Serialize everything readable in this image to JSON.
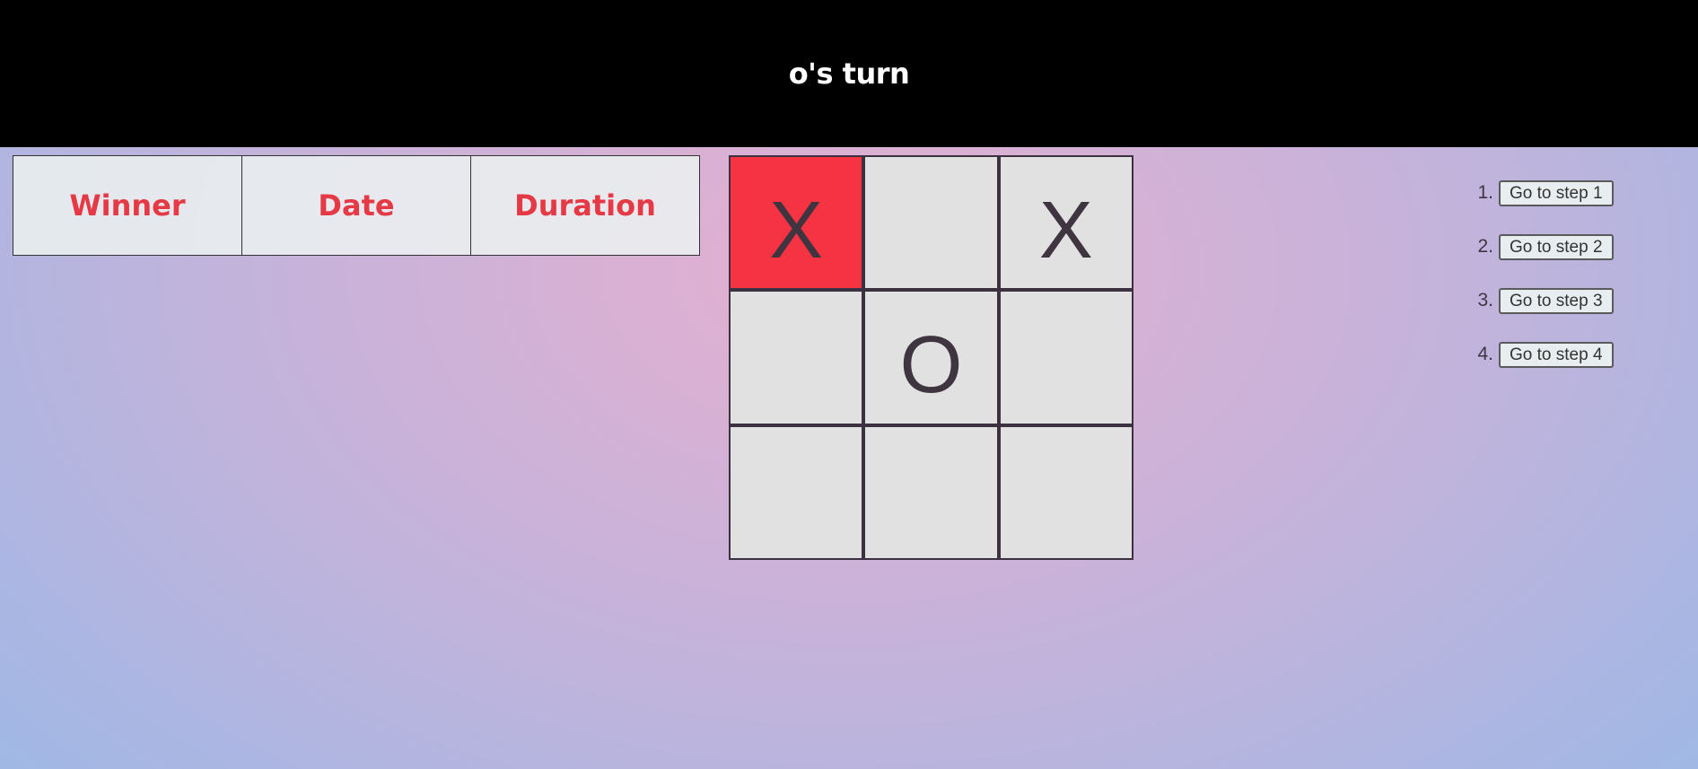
{
  "status": "o's turn",
  "history_table": {
    "headers": [
      "Winner",
      "Date",
      "Duration"
    ]
  },
  "board": {
    "squares": [
      "X",
      "",
      "X",
      "",
      "O",
      "",
      "",
      "",
      ""
    ],
    "highlighted_index": 0,
    "highlight_color": "#f53342"
  },
  "moves": [
    {
      "number": "1.",
      "label": "Go to step 1"
    },
    {
      "number": "2.",
      "label": "Go to step 2"
    },
    {
      "number": "3.",
      "label": "Go to step 3"
    },
    {
      "number": "4.",
      "label": "Go to step 4"
    }
  ],
  "colors": {
    "header_bg": "#000000",
    "header_text": "#ffffff",
    "table_text": "#e63946",
    "mark_color": "#3f3541"
  }
}
